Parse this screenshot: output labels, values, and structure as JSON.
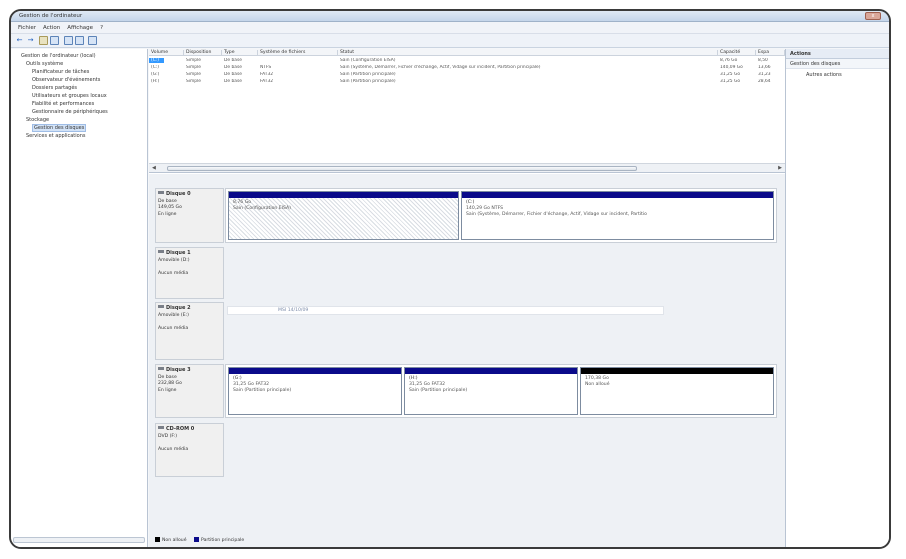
{
  "window": {
    "title": "Gestion de l'ordinateur",
    "close_label": "x"
  },
  "menu": [
    "Fichier",
    "Action",
    "Affichage",
    "?"
  ],
  "tree": [
    {
      "label": "Gestion de l'ordinateur (local)",
      "icon_color": "#6a7f9f"
    },
    {
      "label": "Outils système",
      "icon_color": "#c8a24a"
    },
    {
      "label": "Planificateur de tâches",
      "icon_color": "#6a8fc8"
    },
    {
      "label": "Observateur d'événements",
      "icon_color": "#5f8a5f"
    },
    {
      "label": "Dossiers partagés",
      "icon_color": "#c8a24a"
    },
    {
      "label": "Utilisateurs et groupes locaux",
      "icon_color": "#6a7f9f"
    },
    {
      "label": "Fiabilité et performances",
      "icon_color": "#5f8a5f"
    },
    {
      "label": "Gestionnaire de périphériques",
      "icon_color": "#7a7f88"
    },
    {
      "label": "Stockage",
      "icon_color": "#c8a24a"
    },
    {
      "label": "Gestion des disques",
      "icon_color": "#7a7f88"
    },
    {
      "label": "Services et applications",
      "icon_color": "#6a7f9f"
    }
  ],
  "volume_table": {
    "headers": [
      "Volume",
      "Disposition",
      "Type",
      "Système de fichiers",
      "Statut",
      "Capacité",
      "Espa"
    ],
    "rows": [
      [
        "(C:)",
        "Simple",
        "De base",
        "",
        "Sain (Configuration EISA)",
        "8,76 Go",
        "8,50"
      ],
      [
        "(C:)",
        "Simple",
        "De base",
        "NTFS",
        "Sain (Système, Démarrer, Fichier d'échange, Actif, Vidage sur incident, Partition principale)",
        "140,09 Go",
        "13,66"
      ],
      [
        "(G:)",
        "Simple",
        "De base",
        "FAT32",
        "Sain (Partition principale)",
        "31,25 Go",
        "31,23"
      ],
      [
        "(H:)",
        "Simple",
        "De base",
        "FAT32",
        "Sain (Partition principale)",
        "31,25 Go",
        "28,64"
      ]
    ]
  },
  "disks": [
    {
      "name": "Disque 0",
      "lines": [
        "De base",
        "149,05 Go",
        "En ligne"
      ],
      "partitions": [
        {
          "title": "",
          "size": "8,76 Go",
          "status": "Sain (Configuration EISA)",
          "kind": "primary",
          "hatched": true
        },
        {
          "title": "(C:)",
          "size": "140,29 Go NTFS",
          "status": "Sain (Système, Démarrer, Fichier d'échange, Actif, Vidage sur incident, Partitio",
          "kind": "primary",
          "hatched": false
        }
      ]
    },
    {
      "name": "Disque 1",
      "lines": [
        "Amovible (D:)",
        "",
        "Aucun média"
      ],
      "partitions": []
    },
    {
      "name": "Disque 2",
      "lines": [
        "Amovible (E:)",
        "",
        "Aucun média"
      ],
      "partitions": [],
      "media_text": "MSI 14/10/09"
    },
    {
      "name": "Disque 3",
      "lines": [
        "De base",
        "232,88 Go",
        "En ligne"
      ],
      "partitions": [
        {
          "title": "(G:)",
          "size": "31,25 Go FAT32",
          "status": "Sain (Partition principale)",
          "kind": "primary",
          "hatched": false
        },
        {
          "title": "(H:)",
          "size": "31,25 Go FAT32",
          "status": "Sain (Partition principale)",
          "kind": "primary",
          "hatched": false
        },
        {
          "title": "",
          "size": "170,38 Go",
          "status": "Non alloué",
          "kind": "unalloc",
          "hatched": false
        }
      ]
    },
    {
      "name": "CD-ROM 0",
      "lines": [
        "DVD (F:)",
        "",
        "Aucun média"
      ],
      "partitions": []
    }
  ],
  "legend": [
    {
      "label": "Non alloué",
      "color": "#000000"
    },
    {
      "label": "Partition principale",
      "color": "#0a0a8a"
    }
  ],
  "actions": {
    "header": "Actions",
    "section": "Gestion des disques",
    "more": "Autres actions"
  }
}
